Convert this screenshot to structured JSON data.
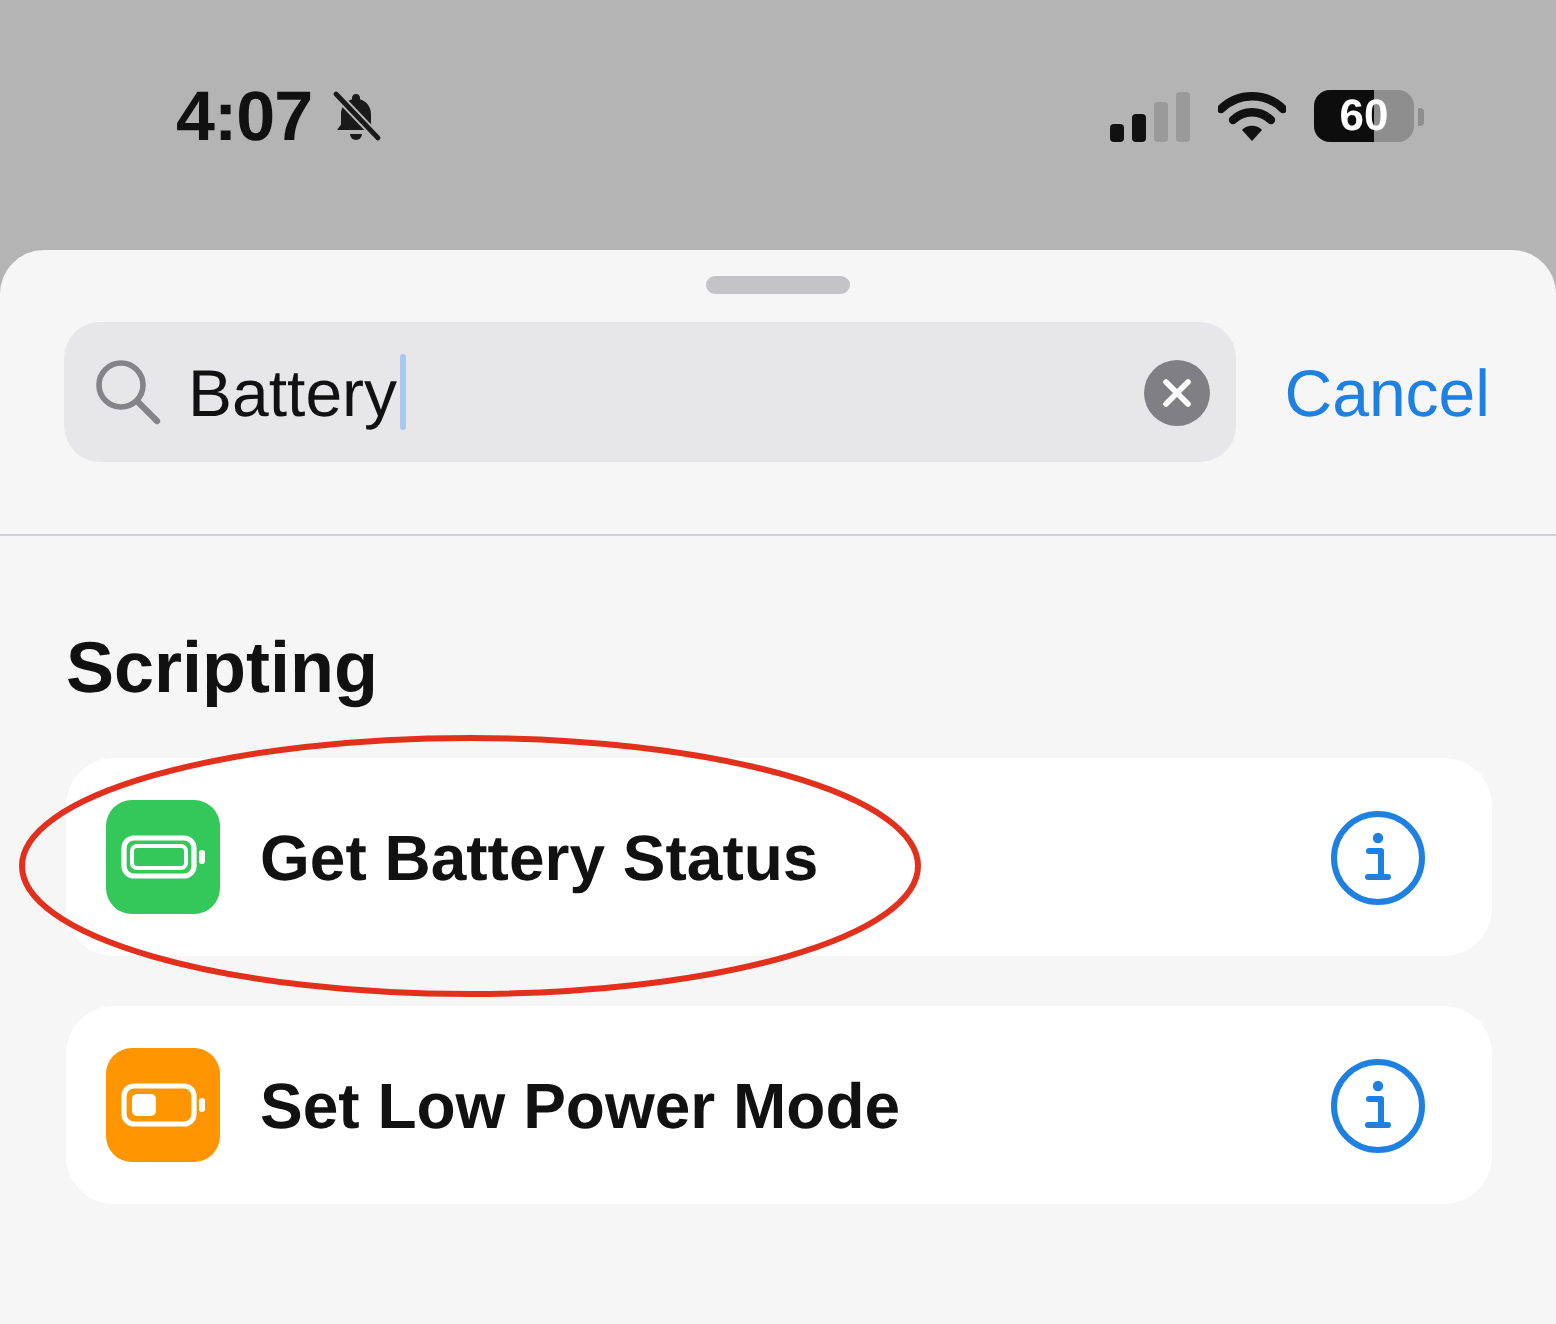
{
  "status_bar": {
    "time": "4:07",
    "battery": "60"
  },
  "search": {
    "value": "Battery",
    "focused": true
  },
  "cancel_button": "Cancel",
  "section": {
    "title": "Scripting",
    "items": [
      {
        "label": "Get Battery Status",
        "color": "#34c759",
        "circled": true
      },
      {
        "label": "Set Low Power Mode",
        "color": "#ff9500",
        "circled": false
      }
    ]
  }
}
